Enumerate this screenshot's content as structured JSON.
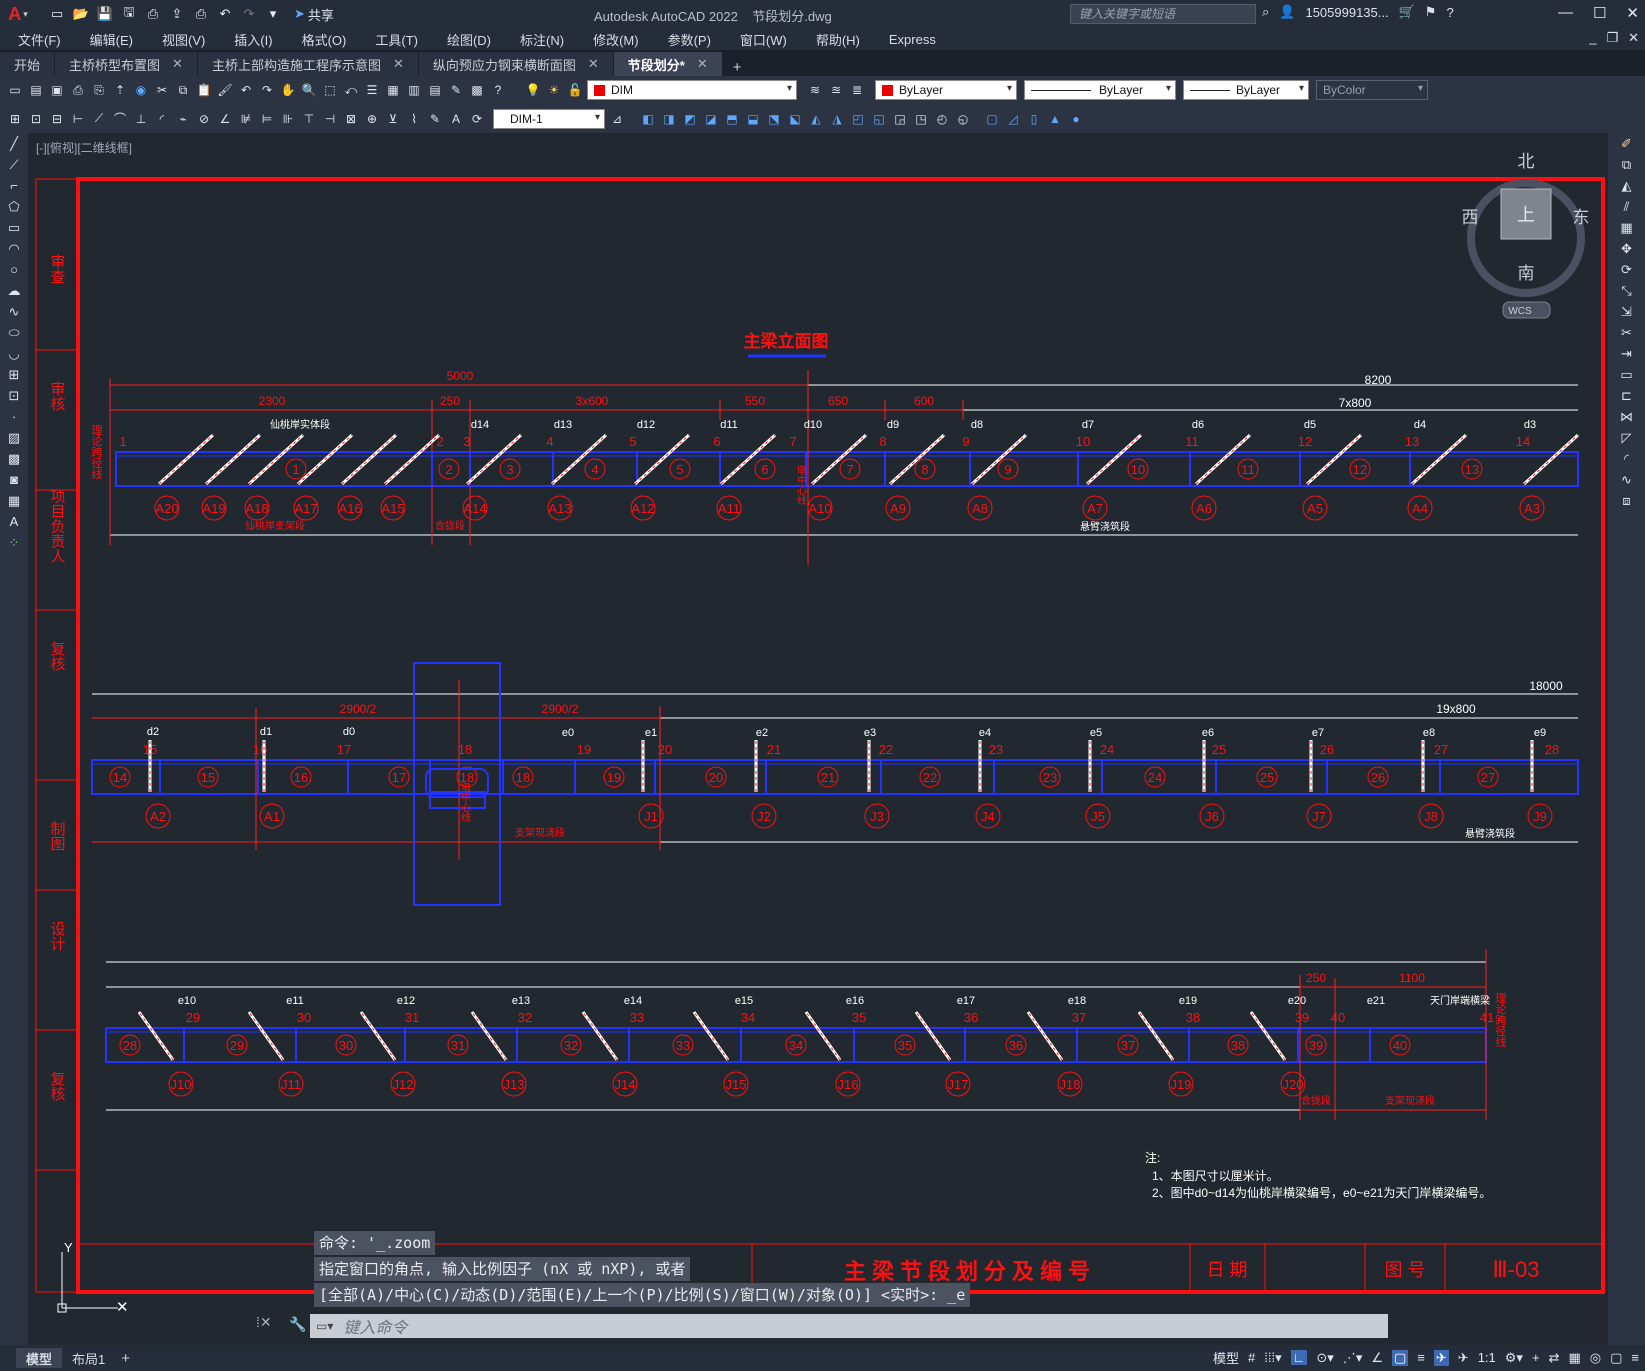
{
  "app": {
    "title": "Autodesk AutoCAD 2022",
    "filename": "节段划分.dwg",
    "search_placeholder": "键入关键字或短语",
    "user": "1505999135...",
    "share_label": "共享"
  },
  "menu": [
    "文件(F)",
    "编辑(E)",
    "视图(V)",
    "插入(I)",
    "格式(O)",
    "工具(T)",
    "绘图(D)",
    "标注(N)",
    "修改(M)",
    "参数(P)",
    "窗口(W)",
    "帮助(H)",
    "Express"
  ],
  "tabs": [
    {
      "label": "开始",
      "closable": false,
      "active": false
    },
    {
      "label": "主桥桥型布置图",
      "closable": true,
      "active": false
    },
    {
      "label": "主桥上部构造施工程序示意图",
      "closable": true,
      "active": false
    },
    {
      "label": "纵向预应力钢束横断面图",
      "closable": true,
      "active": false
    },
    {
      "label": "节段划分*",
      "closable": true,
      "active": true
    }
  ],
  "toolbar": {
    "layer": "DIM",
    "color": "ByLayer",
    "linetype": "ByLayer",
    "lineweight": "ByLayer",
    "plotstyle": "ByColor",
    "dimstyle": "DIM-1"
  },
  "viewport": {
    "label": "[-][俯视][二维线框]"
  },
  "viewcube": {
    "north": "北",
    "south": "南",
    "east": "东",
    "west": "西",
    "top": "上",
    "wcs": "WCS"
  },
  "drawing": {
    "main_title": "主梁立面图",
    "row1_dims": {
      "d5000": "5000",
      "d8200": "8200",
      "d2300": "2300",
      "d250": "250",
      "d3x600": "3x600",
      "d550": "550",
      "d650": "650",
      "d600": "600",
      "d7x800": "7x800"
    },
    "row1_d": [
      "d14",
      "d13",
      "d12",
      "d11",
      "d10",
      "d9",
      "d8",
      "d7",
      "d6",
      "d5",
      "d4",
      "d3"
    ],
    "row1_nodes": [
      "1",
      "2",
      "3",
      "4",
      "5",
      "6",
      "7",
      "8",
      "9",
      "10",
      "11",
      "12",
      "13",
      "14"
    ],
    "row1_segs": [
      "1",
      "2",
      "3",
      "4",
      "5",
      "6",
      "7",
      "8",
      "9",
      "10",
      "11",
      "12",
      "13"
    ],
    "row1_cables": [
      "A20",
      "A19",
      "A18",
      "A17",
      "A16",
      "A15",
      "A14",
      "A13",
      "A12",
      "A11",
      "A10",
      "A9",
      "A8",
      "A7",
      "A6",
      "A5",
      "A4",
      "A3"
    ],
    "row1_labels": {
      "shoring": "仙桃岸支架段",
      "closure": "合拢段",
      "cantilever": "悬臂浇筑段",
      "centerline": "墩中心线",
      "bearing_line": "理论跨径线",
      "notch": "仙桃岸实体段"
    },
    "row2_dims": {
      "d18000": "18000",
      "d2900a": "2900/2",
      "d2900b": "2900/2",
      "d19x800": "19x800"
    },
    "row2_d": [
      "d2",
      "d1",
      "d0"
    ],
    "row2_e": [
      "e0",
      "e1",
      "e2",
      "e3",
      "e4",
      "e5",
      "e6",
      "e7",
      "e8",
      "e9"
    ],
    "row2_nodes": [
      "15",
      "16",
      "17",
      "18",
      "19",
      "20",
      "21",
      "22",
      "23",
      "24",
      "25",
      "26",
      "27",
      "28"
    ],
    "row2_segs": [
      "14",
      "15",
      "16",
      "17",
      "18",
      "18",
      "19",
      "20",
      "21",
      "22",
      "23",
      "24",
      "25",
      "26",
      "27"
    ],
    "row2_cables": [
      "A2",
      "A1",
      "J1",
      "J2",
      "J3",
      "J4",
      "J5",
      "J6",
      "J7",
      "J8",
      "J9"
    ],
    "row2_labels": {
      "support": "支架现浇段",
      "cantilever": "悬臂浇筑段",
      "center": "墩中心线"
    },
    "row3_dims": {
      "d250": "250",
      "d1100": "1100"
    },
    "row3_e": [
      "e10",
      "e11",
      "e12",
      "e13",
      "e14",
      "e15",
      "e16",
      "e17",
      "e18",
      "e19",
      "e20",
      "e21"
    ],
    "row3_nodes": [
      "29",
      "30",
      "31",
      "32",
      "33",
      "34",
      "35",
      "36",
      "37",
      "38",
      "39",
      "40",
      "41"
    ],
    "row3_segs": [
      "28",
      "29",
      "30",
      "31",
      "32",
      "33",
      "34",
      "35",
      "36",
      "37",
      "38",
      "39",
      "40"
    ],
    "row3_cables": [
      "J10",
      "J11",
      "J12",
      "J13",
      "J14",
      "J15",
      "J16",
      "J17",
      "J18",
      "J19",
      "J20"
    ],
    "row3_labels": {
      "closure": "合拢段",
      "support": "支架现浇段",
      "tianmen": "天门岸端横梁",
      "bearing_line": "理论跨径线"
    },
    "notes": [
      "注:",
      "1、本图尺寸以厘米计。",
      "2、图中d0~d14为仙桃岸横梁编号，e0~e21为天门岸横梁编号。"
    ],
    "frame_left": [
      "审查",
      "审核",
      "项目负责人",
      "复核",
      "制图",
      "设计",
      "复核"
    ],
    "titleblock": {
      "title": "主梁节段划分及编号",
      "date_label": "日 期",
      "sheet_label": "图 号",
      "sheet_no": "Ⅲ-03"
    }
  },
  "command": {
    "line1": "命令: '_.zoom",
    "line2": "指定窗口的角点, 输入比例因子 (nX 或 nXP), 或者",
    "line3": "[全部(A)/中心(C)/动态(D)/范围(E)/上一个(P)/比例(S)/窗口(W)/对象(O)] <实时>: _e",
    "prompt": "键入命令"
  },
  "status": {
    "layouts": [
      "模型",
      "布局1"
    ],
    "model_label": "模型",
    "scale": "1:1"
  }
}
